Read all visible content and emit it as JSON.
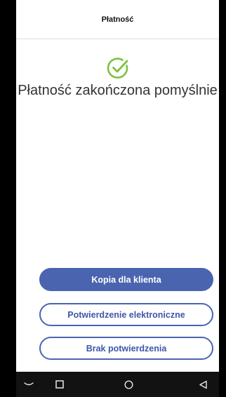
{
  "header": {
    "title": "Płatność"
  },
  "status": {
    "icon": "check-circle-icon",
    "message": "Płatność zakończona pomyślnie",
    "color": "#7dc242"
  },
  "actions": {
    "customer_copy": "Kopia dla klienta",
    "electronic_confirmation": "Potwierdzenie elektroniczne",
    "no_confirmation": "Brak potwierdzenia",
    "accent_color": "#4a64b0"
  },
  "navigation": {
    "keys": [
      "keyboard-hide-icon",
      "recent-apps-icon",
      "home-icon",
      "back-icon"
    ]
  }
}
